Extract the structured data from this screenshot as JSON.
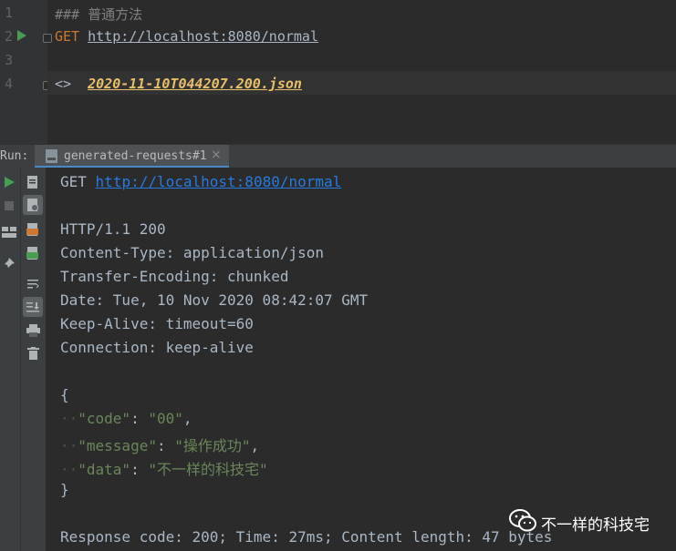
{
  "editor": {
    "line_numbers": [
      "1",
      "2",
      "3",
      "4"
    ],
    "line1_comment": "### 普通方法",
    "line2_method": "GET",
    "line2_url": "http://localhost:8080/normal",
    "line4_prefix": "<>",
    "line4_response_file": "2020-11-10T044207.200.json"
  },
  "run_panel": {
    "label": "Run:",
    "tab_label": "generated-requests#1",
    "tab_close": "×"
  },
  "console": {
    "request_method": "GET",
    "request_url": "http://localhost:8080/normal",
    "status_line": "HTTP/1.1 200",
    "headers": [
      "Content-Type: application/json",
      "Transfer-Encoding: chunked",
      "Date: Tue, 10 Nov 2020 08:42:07 GMT",
      "Keep-Alive: timeout=60",
      "Connection: keep-alive"
    ],
    "json_open": "{",
    "json_close": "}",
    "json_fields": [
      {
        "key": "\"code\"",
        "sep": ": ",
        "value": "\"00\"",
        "trail": ","
      },
      {
        "key": "\"message\"",
        "sep": ": ",
        "value": "\"操作成功\"",
        "trail": ","
      },
      {
        "key": "\"data\"",
        "sep": ": ",
        "value": "\"不一样的科技宅\"",
        "trail": ""
      }
    ],
    "indent_dots": "··",
    "footer": "Response code: 200; Time: 27ms; Content length: 47 bytes"
  },
  "watermark": {
    "text": "不一样的科技宅",
    "icon": "wechat-icon"
  },
  "colors": {
    "keyword": "#cc7832",
    "url": "#287bde",
    "json_key": "#9876aa",
    "json_string": "#6a8759",
    "response_file": "#e8bf6a",
    "run_green": "#499c54"
  }
}
